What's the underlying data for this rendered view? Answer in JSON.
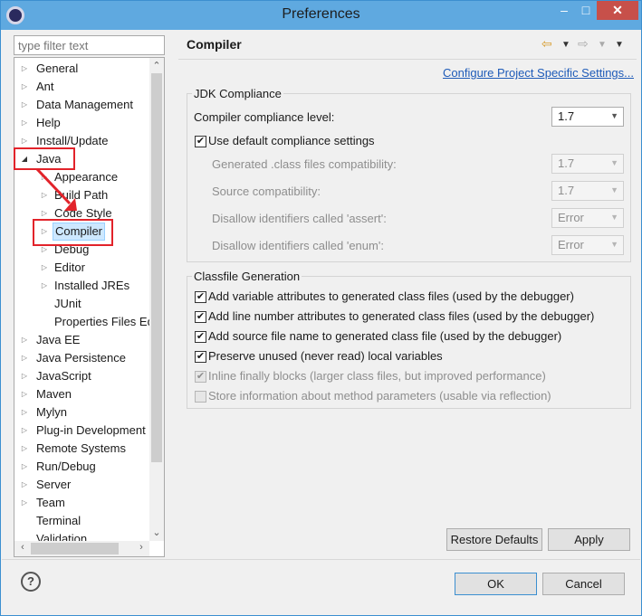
{
  "window": {
    "title": "Preferences",
    "minimize": "–",
    "maximize": "□",
    "close": "✕"
  },
  "filter": {
    "placeholder": "type filter text"
  },
  "tree": {
    "items": [
      "General",
      "Ant",
      "Data Management",
      "Help",
      "Install/Update",
      "Java",
      "Appearance",
      "Build Path",
      "Code Style",
      "Compiler",
      "Debug",
      "Editor",
      "Installed JREs",
      "JUnit",
      "Properties Files Ed",
      "Java EE",
      "Java Persistence",
      "JavaScript",
      "Maven",
      "Mylyn",
      "Plug-in Development",
      "Remote Systems",
      "Run/Debug",
      "Server",
      "Team",
      "Terminal",
      "Validation"
    ],
    "selected": "Compiler"
  },
  "page": {
    "title": "Compiler",
    "configure_link": "Configure Project Specific Settings...",
    "jdk_group": {
      "legend": "JDK Compliance",
      "compliance_label": "Compiler compliance level:",
      "compliance_value": "1.7",
      "use_default_label": "Use default compliance settings",
      "use_default_checked": true,
      "rows": [
        {
          "label": "Generated .class files compatibility:",
          "value": "1.7"
        },
        {
          "label": "Source compatibility:",
          "value": "1.7"
        },
        {
          "label": "Disallow identifiers called 'assert':",
          "value": "Error"
        },
        {
          "label": "Disallow identifiers called 'enum':",
          "value": "Error"
        }
      ]
    },
    "classfile_group": {
      "legend": "Classfile Generation",
      "options": [
        {
          "label": "Add variable attributes to generated class files (used by the debugger)",
          "checked": true,
          "enabled": true
        },
        {
          "label": "Add line number attributes to generated class files (used by the debugger)",
          "checked": true,
          "enabled": true
        },
        {
          "label": "Add source file name to generated class file (used by the debugger)",
          "checked": true,
          "enabled": true
        },
        {
          "label": "Preserve unused (never read) local variables",
          "checked": true,
          "enabled": true
        },
        {
          "label": "Inline finally blocks (larger class files, but improved performance)",
          "checked": true,
          "enabled": false
        },
        {
          "label": "Store information about method parameters (usable via reflection)",
          "checked": false,
          "enabled": false
        }
      ]
    }
  },
  "buttons": {
    "restore_defaults": "Restore Defaults",
    "apply": "Apply",
    "ok": "OK",
    "cancel": "Cancel"
  },
  "icons": {
    "back": "back-arrow-icon",
    "forward": "forward-arrow-icon",
    "menu": "view-menu-icon",
    "help": "help-icon"
  },
  "colors": {
    "titlebar": "#5fa9e0",
    "close": "#c7504a",
    "link": "#1e5bb8",
    "selection": "#cde8ff",
    "annotation": "#e2232a"
  }
}
